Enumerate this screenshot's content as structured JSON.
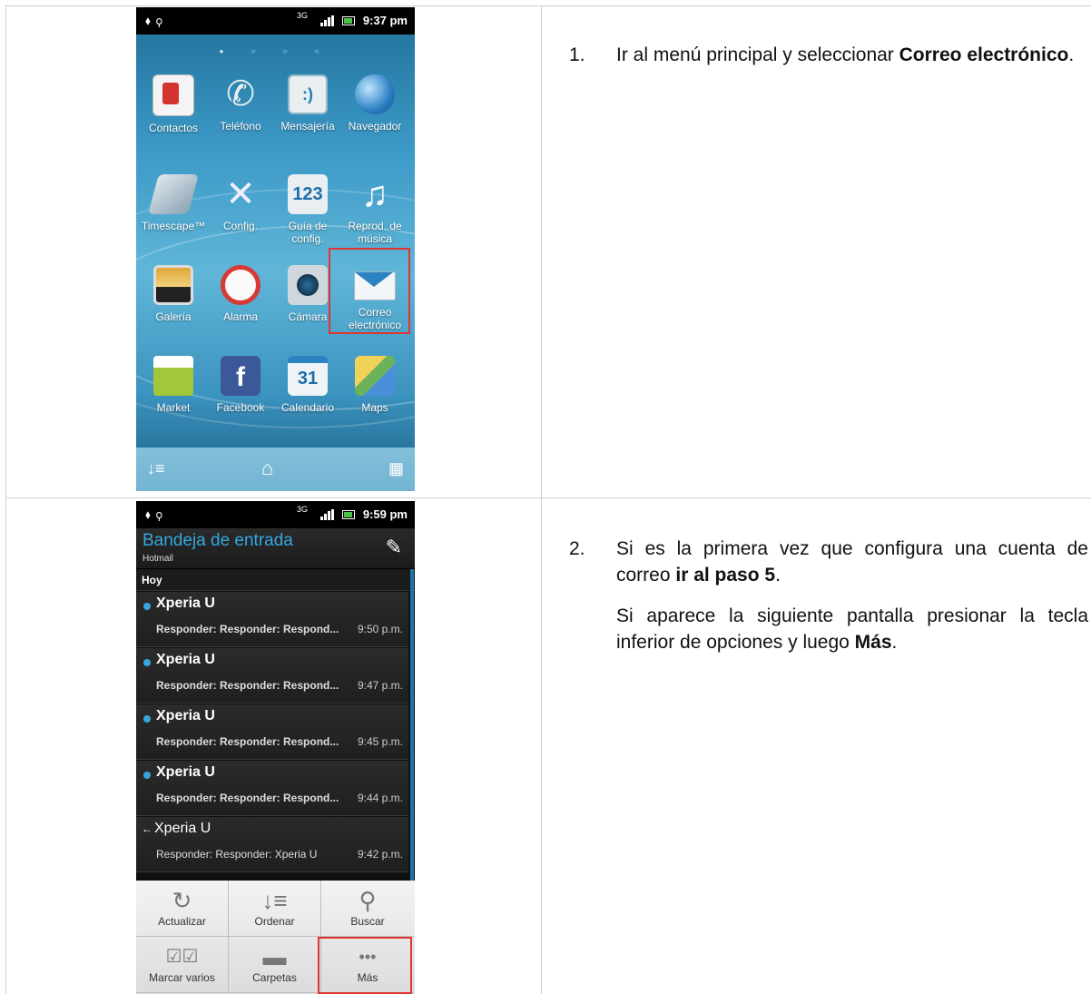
{
  "phone1": {
    "status_time": "9:37 pm",
    "signal_label": "3G",
    "apps": [
      {
        "label": "Contactos",
        "icon": "contacts-icon"
      },
      {
        "label": "Teléfono",
        "icon": "phone-icon"
      },
      {
        "label": "Mensajería",
        "icon": "messaging-icon"
      },
      {
        "label": "Navegador",
        "icon": "browser-icon"
      },
      {
        "label": "Timescape™",
        "icon": "timescape-icon"
      },
      {
        "label": "Config.",
        "icon": "settings-icon"
      },
      {
        "label": "Guía de config.",
        "icon": "setup-guide-icon"
      },
      {
        "label": "Reprod. de música",
        "icon": "music-icon"
      },
      {
        "label": "Galería",
        "icon": "gallery-icon"
      },
      {
        "label": "Alarma",
        "icon": "alarm-icon"
      },
      {
        "label": "Cámara",
        "icon": "camera-icon"
      },
      {
        "label": "Correo electrónico",
        "icon": "email-icon"
      },
      {
        "label": "Market",
        "icon": "market-icon"
      },
      {
        "label": "Facebook",
        "icon": "facebook-icon"
      },
      {
        "label": "Calendario",
        "icon": "calendar-icon"
      },
      {
        "label": "Maps",
        "icon": "maps-icon"
      }
    ],
    "calendar_day": "31",
    "setup_digits": "123",
    "highlight_color": "#e23333"
  },
  "phone2": {
    "status_time": "9:59 pm",
    "signal_label": "3G",
    "title": "Bandeja de entrada",
    "account": "Hotmail",
    "section": "Hoy",
    "mails": [
      {
        "from": "Xperia U",
        "subject": "Responder: Responder: Respond...",
        "time": "9:50 p.m.",
        "unread": true
      },
      {
        "from": "Xperia U",
        "subject": "Responder: Responder: Respond...",
        "time": "9:47 p.m.",
        "unread": true
      },
      {
        "from": "Xperia U",
        "subject": "Responder: Responder: Respond...",
        "time": "9:45 p.m.",
        "unread": true
      },
      {
        "from": "Xperia U",
        "subject": "Responder: Responder: Respond...",
        "time": "9:44 p.m.",
        "unread": true
      },
      {
        "from": "Xperia U",
        "subject": "Responder: Responder: Xperia U",
        "time": "9:42 p.m.",
        "unread": false
      }
    ],
    "menu": [
      {
        "label": "Actualizar",
        "icon": "refresh-icon"
      },
      {
        "label": "Ordenar",
        "icon": "sort-icon"
      },
      {
        "label": "Buscar",
        "icon": "search-icon"
      },
      {
        "label": "Marcar varios",
        "icon": "mark-multiple-icon"
      },
      {
        "label": "Carpetas",
        "icon": "folder-icon"
      },
      {
        "label": "Más",
        "icon": "more-icon"
      }
    ],
    "accent_color": "#35a7e0"
  },
  "steps": {
    "step1": {
      "num": "1.",
      "text_a": "Ir al menú principal y seleccionar ",
      "bold_a": "Correo electrónico",
      "text_b": "."
    },
    "step2": {
      "num": "2.",
      "p1_a": "Si es la primera vez que configura una cuenta de correo ",
      "p1_bold": "ir al paso 5",
      "p1_b": ".",
      "p2_a": "Si aparece la siguiente pantalla presionar la tecla inferior de opciones y luego ",
      "p2_bold": "Más",
      "p2_b": "."
    }
  }
}
